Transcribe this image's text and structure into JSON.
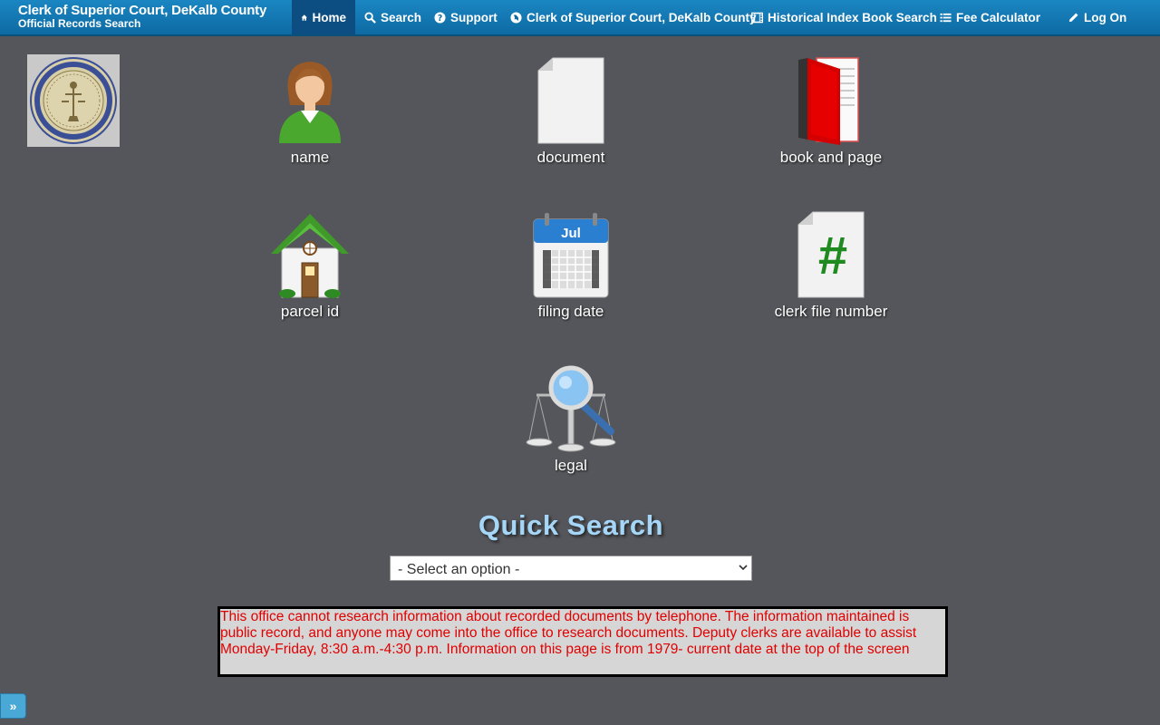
{
  "header": {
    "title": "Clerk of Superior Court, DeKalb County",
    "subtitle": "Official Records Search"
  },
  "nav": {
    "home": "Home",
    "search": "Search",
    "support": "Support",
    "clerk": "Clerk of Superior Court, DeKalb County",
    "historical": "Historical Index Book Search",
    "fee": "Fee Calculator",
    "logon": "Log On"
  },
  "tiles": {
    "name": "name",
    "document": "document",
    "book": "book and page",
    "parcel": "parcel id",
    "filing": "filing date",
    "clerk_file": "clerk file number",
    "legal": "legal"
  },
  "calendar": {
    "month": "Jul"
  },
  "clerk_file_symbol": "#",
  "quick_search": {
    "title": "Quick Search",
    "selected": "- Select an option -"
  },
  "notice": {
    "text": " This office cannot research information about recorded documents by telephone. The information maintained is public record, and anyone may come into the office to research documents. Deputy clerks are available to assist Monday-Friday, 8:30 a.m.-4:30 p.m. Information on this page is from 1979- current date at the top of the screen"
  },
  "toggle": {
    "label": "»"
  },
  "colors": {
    "background": "#55565b",
    "navbar": "#1478b4",
    "nav_active": "#0d4e82",
    "quick_search_title": "#a5d6f7",
    "notice_text": "#e00000",
    "notice_bg": "#d6d6d6"
  }
}
